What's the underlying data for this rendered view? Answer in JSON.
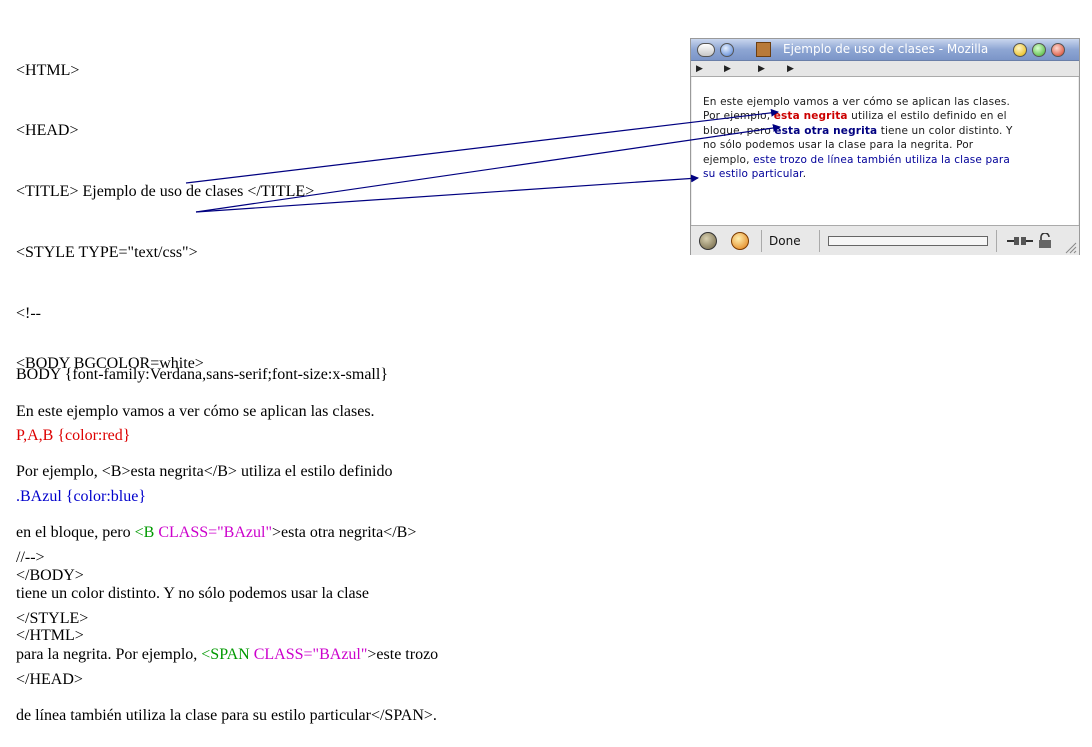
{
  "source_code": {
    "head_lines": [
      "<HTML>",
      "<HEAD>",
      "<TITLE> Ejemplo de uso de clases </TITLE>",
      "<STYLE TYPE=\"text/css\">",
      "<!--",
      "BODY {font-family:Verdana,sans-serif;font-size:x-small}"
    ],
    "red_rule": "P,A,B {color:red}",
    "blue_rule": ".BAzul {color:blue}",
    "tail_lines": [
      "//-->",
      "</STYLE>",
      "</HEAD>"
    ],
    "body_open": "<BODY BGCOLOR=white>",
    "para": {
      "l1": "En este ejemplo vamos a ver cómo se aplican las clases.",
      "l2": "Por ejemplo, <B>esta negrita</B> utiliza el estilo definido",
      "l3_a": "en el bloque, pero ",
      "l3_tag": "<B ",
      "l3_attr": "CLASS=\"BAzul\"",
      "l3_b": ">esta otra negrita</B>",
      "l4": "tiene un color distinto. Y no sólo podemos usar la clase",
      "l5_a": "para la negrita. Por ejemplo, ",
      "l5_tag": "<SPAN ",
      "l5_attr": "CLASS=\"BAzul\"",
      "l5_b": ">este trozo",
      "l6": "de línea también utiliza la clase para su estilo particular</SPAN>."
    },
    "closing": [
      "</BODY>",
      "</HTML>"
    ]
  },
  "browser": {
    "title": "Ejemplo de uso de clases - Mozilla",
    "content": {
      "l1": "En este ejemplo vamos a ver cómo se aplican las clases.",
      "l2_a": "Por ejemplo, ",
      "l2_bold_red": "esta negrita",
      "l2_b": " utiliza el estilo definido en el",
      "l3_a": "bloque, pero ",
      "l3_bold_blue": "esta otra negrita",
      "l3_b": " tiene un color distinto. Y",
      "l4": "no sólo podemos usar la clase para la negrita. Por",
      "l5_a": "ejemplo, ",
      "l5_blue": "este trozo de línea también utiliza la clase para",
      "l6_blue": "su estilo particular",
      "l6_end": "."
    },
    "status_text": "Done",
    "progress": 0
  },
  "colors": {
    "red": "#dd0000",
    "blue": "#0000cc",
    "green": "#009900",
    "magenta": "#cc00cc",
    "arrow_red_rule": "#000080",
    "arrow_blue_rule": "#000080"
  }
}
